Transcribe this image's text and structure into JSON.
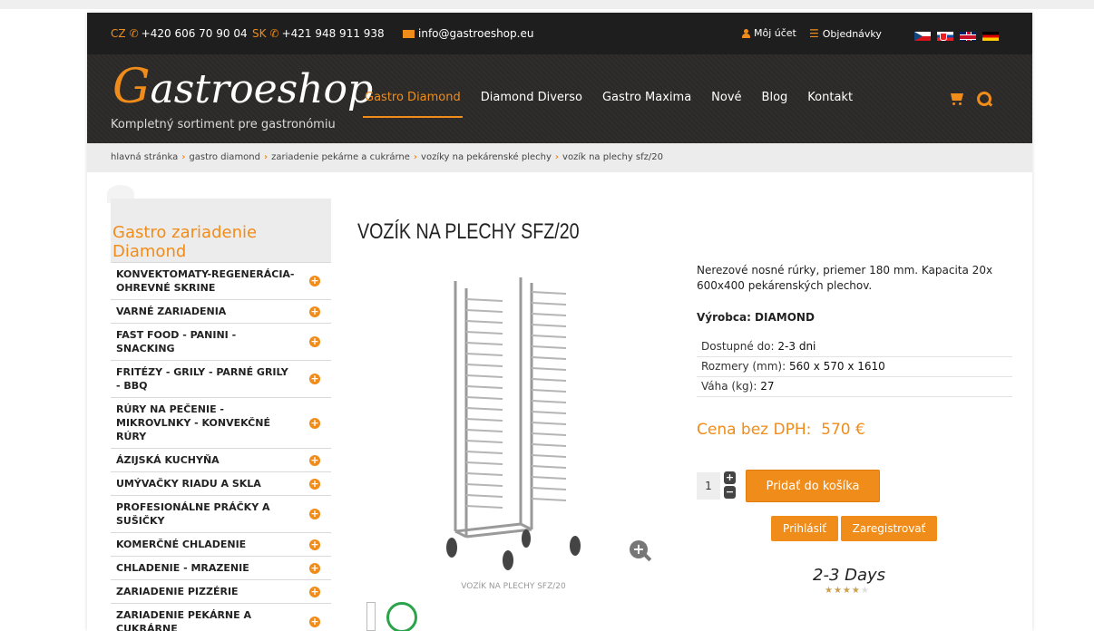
{
  "topbar": {
    "cz_code": "CZ",
    "cz_phone": "+420 606 70 90 04",
    "sk_code": "SK",
    "sk_phone": "+421 948 911 938",
    "email": "info@gastroeshop.eu",
    "account": "Môj účet",
    "orders": "Objednávky",
    "languages": [
      "cz-flag-icon",
      "sk-flag-icon",
      "uk-flag-icon",
      "de-flag-icon"
    ]
  },
  "header": {
    "logo_initial": "G",
    "logo_rest": "astroeshop",
    "tagline": "Kompletný sortiment pre gastronómiu",
    "nav": [
      "Gastro Diamond",
      "Diamond Diverso",
      "Gastro Maxima",
      "Nové",
      "Blog",
      "Kontakt"
    ],
    "active_nav": "Gastro Diamond"
  },
  "breadcrumb": [
    "hlavná stránka",
    "gastro diamond",
    "zariadenie pekárne a cukrárne",
    "vozíky na pekárenské plechy",
    "vozík na plechy sfz/20"
  ],
  "sidebar": {
    "title": "Gastro zariadenie Diamond",
    "categories": [
      "KONVEKTOMATY-REGENERÁCIA-OHREVNÉ SKRINE",
      "VARNÉ ZARIADENIA",
      "FAST FOOD - PANINI - SNACKING",
      "FRITÉZY - GRILY - PARNÉ GRILY - BBQ",
      "RÚRY NA PEČENIE - MIKROVLNKY - KONVEKČNÉ RÚRY",
      "ÁZIJSKÁ KUCHYŇA",
      "UMÝVAČKY RIADU A SKLA",
      "PROFESIONÁLNE PRÁČKY A SUŠIČKY",
      "KOMERČNÉ CHLADENIE",
      "CHLADENIE - MRAZENIE",
      "ZARIADENIE PIZZÉRIE",
      "ZARIADENIE PEKÁRNE A CUKRÁRNE"
    ]
  },
  "product": {
    "title": "VOZÍK NA PLECHY SFZ/20",
    "caption": "VOZÍK NA PLECHY SFZ/20",
    "description": "Nerezové nosné rúrky, priemer 180 mm. Kapacita 20x 600x400 pekárenských plechov.",
    "manufacturer": "Výrobca: DIAMOND",
    "specs": [
      {
        "label": "Dostupné do:",
        "value": "2-3 dni"
      },
      {
        "label": "Rozmery (mm):",
        "value": "560 x 570 x 1610"
      },
      {
        "label": "Váha (kg):",
        "value": "27"
      }
    ],
    "price_label": "Cena bez DPH:",
    "price": "570 €",
    "quantity": "1",
    "add_to_cart": "Pridať do košíka",
    "login": "Prihlásiť",
    "register": "Zaregistrovať",
    "delivery": "2-3 Days",
    "rating": 4,
    "rating_max": 5
  },
  "colors": {
    "accent": "#f08c1a",
    "dark": "#1e1e1e",
    "sidebar_bg": "#ececec"
  }
}
